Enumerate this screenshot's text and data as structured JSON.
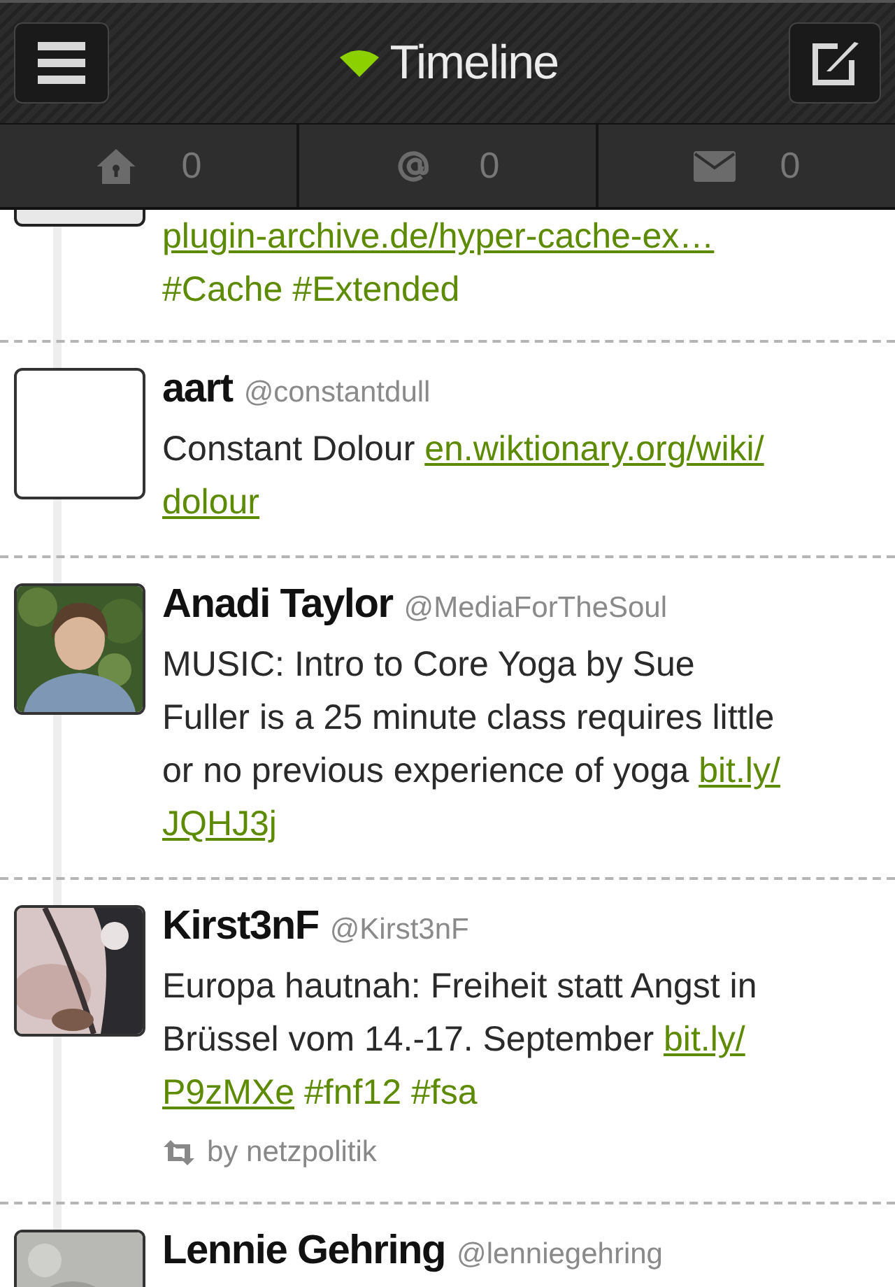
{
  "header": {
    "title": "Timeline"
  },
  "tabs": [
    {
      "kind": "home",
      "count": "0"
    },
    {
      "kind": "mention",
      "count": "0"
    },
    {
      "kind": "mail",
      "count": "0"
    }
  ],
  "tweets": [
    {
      "avatar": {
        "kind": "cut"
      },
      "body": [
        [
          {
            "kind": "link",
            "text": "plugin-archive.de/hyper-cache-ex…"
          }
        ],
        [
          {
            "kind": "tag",
            "text": "#Cache"
          },
          {
            "kind": "tag",
            "text": "#Extended"
          }
        ]
      ]
    },
    {
      "name": "aart",
      "handle": "@constantdull",
      "avatar": {
        "kind": "blank"
      },
      "body": [
        [
          {
            "kind": "text",
            "text": "Constant Dolour "
          },
          {
            "kind": "link",
            "text": "en.wiktionary.org/wiki/"
          }
        ],
        [
          {
            "kind": "link",
            "text": "dolour"
          }
        ]
      ]
    },
    {
      "name": "Anadi Taylor",
      "handle": "@MediaForTheSoul",
      "avatar": {
        "kind": "picture"
      },
      "body": [
        [
          {
            "kind": "text",
            "text": "MUSIC: Intro to Core Yoga by Sue"
          }
        ],
        [
          {
            "kind": "text",
            "text": "Fuller is a 25 minute class requires little"
          }
        ],
        [
          {
            "kind": "text",
            "text": "or no previous experience of yoga "
          },
          {
            "kind": "link",
            "text": "bit.ly/"
          }
        ],
        [
          {
            "kind": "link",
            "text": "JQHJ3j"
          }
        ]
      ]
    },
    {
      "name": "Kirst3nF",
      "handle": "@Kirst3nF",
      "avatar": {
        "kind": "picture"
      },
      "body": [
        [
          {
            "kind": "text",
            "text": "Europa hautnah: Freiheit statt Angst in"
          }
        ],
        [
          {
            "kind": "text",
            "text": "Brüssel vom 14.-17. September "
          },
          {
            "kind": "link",
            "text": "bit.ly/"
          }
        ],
        [
          {
            "kind": "link",
            "text": "P9zMXe"
          },
          {
            "kind": "tag",
            "text": "#fnf12"
          },
          {
            "kind": "tag",
            "text": "#fsa"
          }
        ]
      ],
      "retweeted_by": "by netzpolitik"
    },
    {
      "name": "Lennie Gehring",
      "handle": "@lenniegehring",
      "avatar": {
        "kind": "picture"
      }
    }
  ]
}
